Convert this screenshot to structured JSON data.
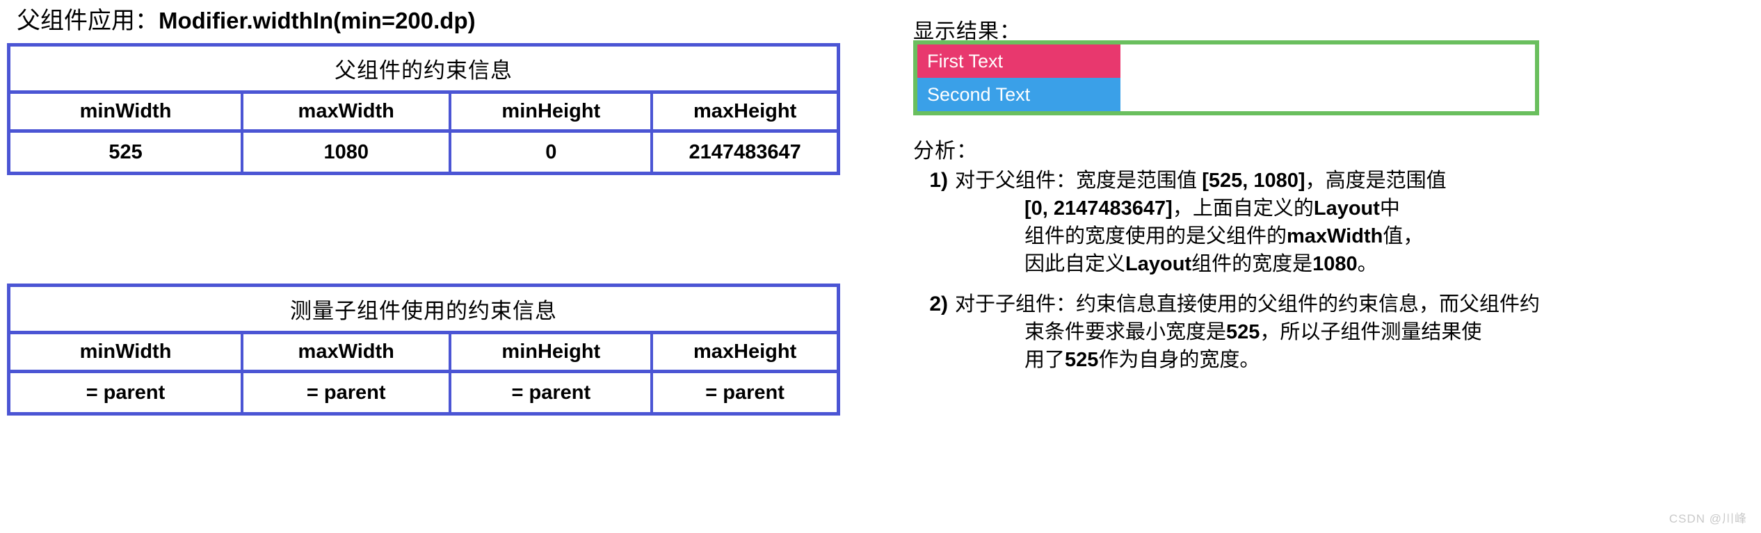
{
  "left": {
    "parent_title_prefix": "父组件应用：",
    "parent_title_code": "Modifier.widthIn(min=200.dp)",
    "tables": [
      {
        "caption": "父组件的约束信息",
        "headers": [
          "minWidth",
          "maxWidth",
          "minHeight",
          "maxHeight"
        ],
        "values": [
          "525",
          "1080",
          "0",
          "2147483647"
        ]
      },
      {
        "caption": "测量子组件使用的约束信息",
        "headers": [
          "minWidth",
          "maxWidth",
          "minHeight",
          "maxHeight"
        ],
        "values": [
          "= parent",
          "= parent",
          "= parent",
          "= parent"
        ]
      }
    ]
  },
  "right": {
    "result_label": "显示结果：",
    "preview": {
      "first_text": "First Text",
      "second_text": "Second Text",
      "border_color": "#6abf5e",
      "first_bg": "#e8386e",
      "second_bg": "#3aa0e8"
    },
    "analysis_label": "分析：",
    "analysis_items": [
      {
        "marker": "1)",
        "line1_plain": "对于父组件：宽度是范围值 ",
        "line1_bold": "[525, 1080]",
        "line1_tail": "，高度是范围值",
        "line2_bold": "[0, 2147483647]",
        "line2_plain": "，上面自定义的",
        "line2_bold2": "Layout",
        "line2_tail": "中",
        "line3_plain": "组件的宽度使用的是父组件的",
        "line3_bold": "maxWidth",
        "line3_tail": "值，",
        "line4_plain": "因此自定义",
        "line4_bold": "Layout",
        "line4_plain2": "组件的宽度是",
        "line4_bold2": "1080",
        "line4_tail": "。"
      },
      {
        "marker": "2)",
        "line1_plain": "对于子组件：约束信息直接使用的父组件的约束信息，而父组件约",
        "line2_plain": "束条件要求最小宽度是",
        "line2_bold": "525",
        "line2_tail": "，所以子组件测量结果使",
        "line3_plain": "用了",
        "line3_bold": "525",
        "line3_tail": "作为自身的宽度。"
      }
    ]
  },
  "watermark": "CSDN @川峰",
  "colors": {
    "table_border": "#4b55d4",
    "preview_border": "#6abf5e",
    "first_block": "#e8386e",
    "second_block": "#3aa0e8"
  }
}
